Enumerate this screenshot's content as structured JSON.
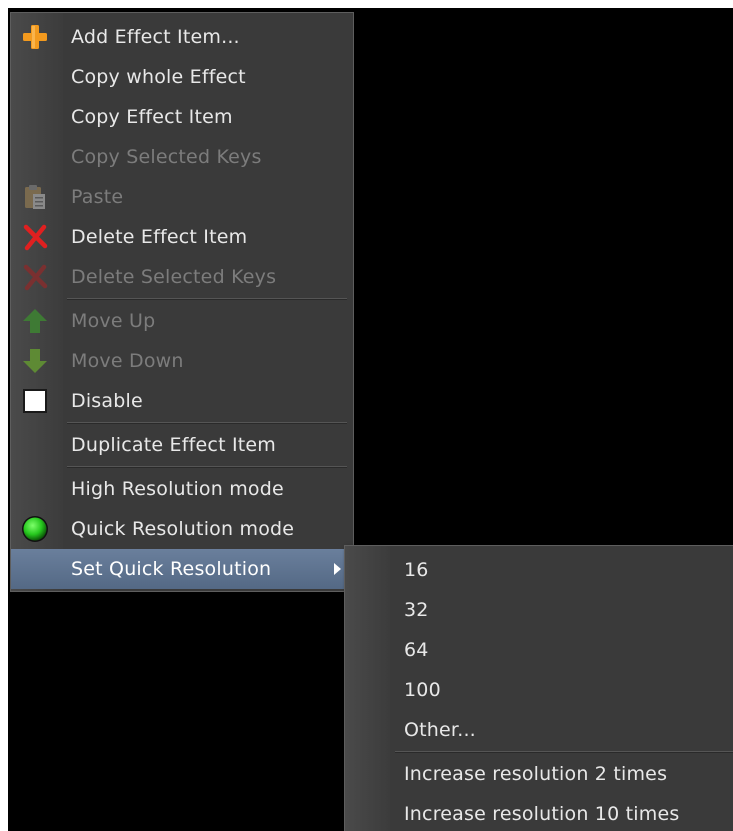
{
  "main_menu": {
    "items": [
      {
        "label": "Add Effect Item...",
        "icon": "plus-icon",
        "enabled": true
      },
      {
        "label": "Copy whole Effect",
        "icon": "",
        "enabled": true
      },
      {
        "label": "Copy Effect Item",
        "icon": "",
        "enabled": true
      },
      {
        "label": "Copy Selected Keys",
        "icon": "",
        "enabled": false
      },
      {
        "label": "Paste",
        "icon": "clipboard-icon",
        "enabled": false
      },
      {
        "label": "Delete Effect Item",
        "icon": "delete-x-icon",
        "enabled": true
      },
      {
        "label": "Delete Selected Keys",
        "icon": "delete-x-icon",
        "enabled": false
      },
      {
        "label": "Move Up",
        "icon": "arrow-up-icon",
        "enabled": false
      },
      {
        "label": "Move Down",
        "icon": "arrow-down-icon",
        "enabled": false
      },
      {
        "label": "Disable",
        "icon": "checkbox-icon",
        "enabled": true
      },
      {
        "label": "Duplicate Effect Item",
        "icon": "",
        "enabled": true
      },
      {
        "label": "High Resolution mode",
        "icon": "",
        "enabled": true
      },
      {
        "label": "Quick Resolution mode",
        "icon": "green-dot-icon",
        "enabled": true,
        "checked": true
      },
      {
        "label": "Set Quick Resolution",
        "icon": "",
        "enabled": true,
        "highlighted": true,
        "has_submenu": true
      }
    ]
  },
  "sub_menu": {
    "items": [
      {
        "label": "16"
      },
      {
        "label": "32"
      },
      {
        "label": "64"
      },
      {
        "label": "100"
      },
      {
        "label": "Other..."
      },
      {
        "label": "Increase resolution 2 times"
      },
      {
        "label": "Increase resolution 10 times"
      }
    ]
  },
  "colors": {
    "menu_bg": "#3a3a3a",
    "text": "#e8e8e8",
    "disabled_text": "#7c7c7c",
    "highlight": "#5f7491",
    "plus_orange": "#f39a1e",
    "delete_red": "#e02020",
    "arrow_green": "#4caa3a",
    "status_green": "#26c81e"
  }
}
